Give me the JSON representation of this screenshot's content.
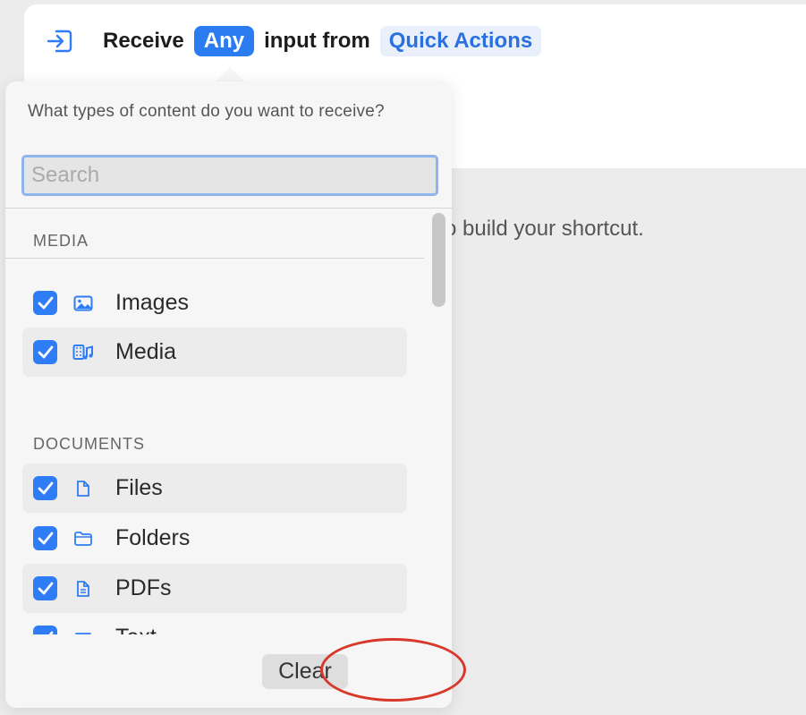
{
  "header": {
    "word_receive": "Receive",
    "any_label": "Any",
    "word_input_from": "input from",
    "source_label": "Quick Actions",
    "icon": "import-arrow-icon"
  },
  "background_hint": "o build your shortcut.",
  "popover": {
    "prompt": "What types of content do you want to receive?",
    "search_placeholder": "Search",
    "search_value": "",
    "sections": [
      {
        "title": "MEDIA",
        "items": [
          {
            "label": "Images",
            "checked": true,
            "icon": "photo-icon"
          },
          {
            "label": "Media",
            "checked": true,
            "icon": "film-music-icon"
          }
        ]
      },
      {
        "title": "DOCUMENTS",
        "items": [
          {
            "label": "Files",
            "checked": true,
            "icon": "document-icon"
          },
          {
            "label": "Folders",
            "checked": true,
            "icon": "folder-icon"
          },
          {
            "label": "PDFs",
            "checked": true,
            "icon": "pdf-document-icon"
          },
          {
            "label": "Text",
            "checked": true,
            "icon": "text-icon"
          }
        ]
      }
    ],
    "clear_label": "Clear"
  },
  "colors": {
    "accent": "#2e7cf6",
    "annotation": "#d8382b"
  }
}
